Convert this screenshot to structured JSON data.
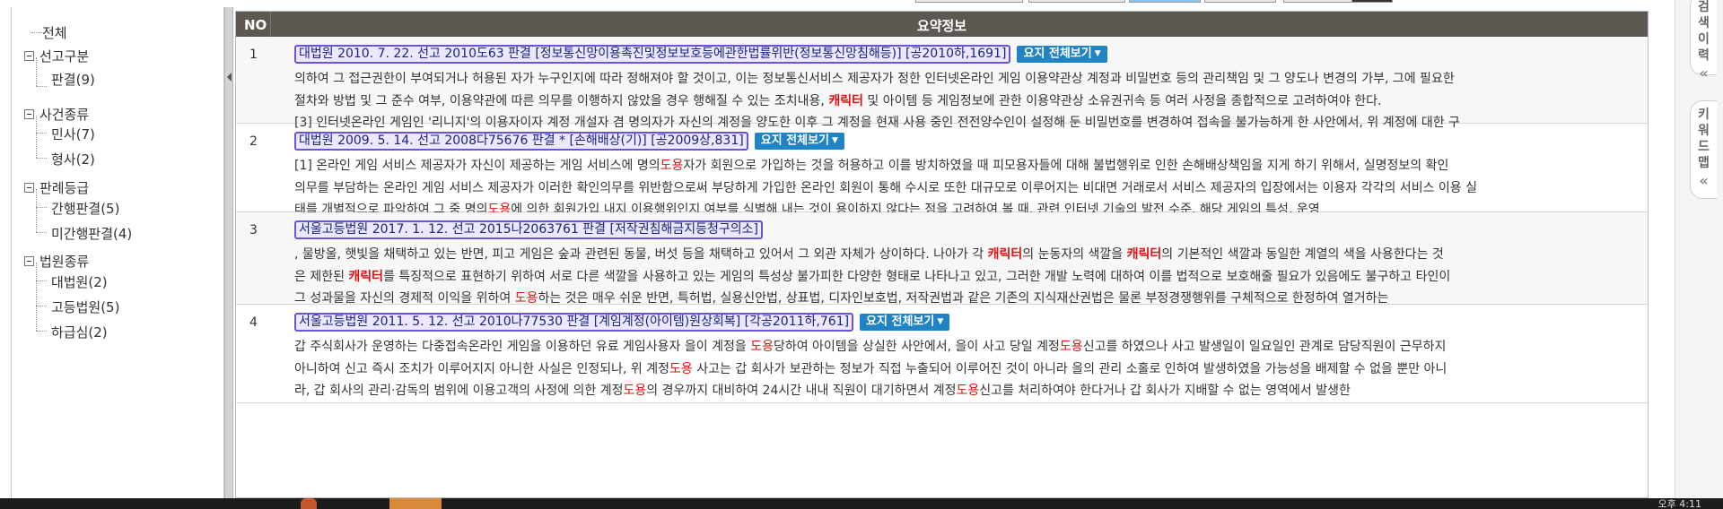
{
  "tree": {
    "all": "전체",
    "groups": [
      {
        "label": "선고구분",
        "children": [
          "판결(9)"
        ]
      },
      {
        "label": "사건종류",
        "children": [
          "민사(7)",
          "형사(2)"
        ]
      },
      {
        "label": "판례등급",
        "children": [
          "간행판결(5)",
          "미간행판결(4)"
        ]
      },
      {
        "label": "법원종류",
        "children": [
          "대법원(2)",
          "고등법원(5)",
          "하급심(2)"
        ]
      }
    ]
  },
  "table": {
    "col_no": "NO",
    "col_info": "요약정보",
    "yoji_label": "요지 전체보기",
    "rows": [
      {
        "no": "1",
        "title": "대법원 2010. 7. 22. 선고 2010도63 판결 [정보통신망이용촉진및정보보호등에관한법률위반(정보통신망침해등)] [공2010하,1691]",
        "has_yoji": true,
        "lines": [
          [
            {
              "t": "의하여 그 접근권한이 부여되거나 허용된 자가 누구인지에 따라 정해져야 할 것이고, 이는 정보통신서비스 제공자가 정한 인터넷온라인 게임 이용약관상 계정과 비밀번호 등의 관리책임 및 그 양도나 변경의 가부, 그에 필요한"
            }
          ],
          [
            {
              "t": "절차와 방법 및 그 준수 여부, 이용약관에 따른 의무를 이행하지 않았을 경우 행해질 수 있는 조치내용, "
            },
            {
              "t": "캐릭터",
              "h": "kr"
            },
            {
              "t": " 및 아이템 등 게임정보에 관한 이용약관상 소유권귀속 등 여러 사정을 종합적으로 고려하여야 한다."
            }
          ],
          [
            {
              "t": "[3] 인터넷온라인 게임인 '리니지'의 이용자이자 계정 개설자 겸 명의자가 자신의 계정을 양도한 이후 그 계정을 현재 사용 중인 전전양수인이 설정해 둔 비밀번호를 변경하여 접속을 불가능하게 한 사안에서, 위 계정에 대한 구"
            }
          ]
        ]
      },
      {
        "no": "2",
        "title": "대법원 2009. 5. 14. 선고 2008다75676 판결 * [손해배상(기)] [공2009상,831]",
        "has_yoji": true,
        "lines": [
          [
            {
              "t": "[1] 온라인 게임 서비스 제공자가 자신이 제공하는 게임 서비스에 명의"
            },
            {
              "t": "도용",
              "h": "do"
            },
            {
              "t": "자가 회원으로 가입하는 것을 허용하고 이를 방치하였을 때 피모용자들에 대해 불법행위로 인한 손해배상책임을 지게 하기 위해서, 실명정보의 확인"
            }
          ],
          [
            {
              "t": "의무를 부담하는 온라인 게임 서비스 제공자가 이러한 확인의무를 위반함으로써 부당하게 가입한 온라인 회원이 통해 수시로 또한 대규모로 이루어지는 비대면 거래로서 서비스 제공자의 입장에서는 이용자 각각의 서비스 이용 실"
            }
          ],
          [
            {
              "t": "태를 개별적으로 파악하여 그 중 명의"
            },
            {
              "t": "도용",
              "h": "do"
            },
            {
              "t": "에 의한 회원가입 내지 이용행위인지 여부를 식별해 내는 것이 용이하지 않다는 점을 고려하여 볼 때, 관련 인터넷 기술의 발전 수준, 해당 게임의 특성, 운영"
            }
          ]
        ]
      },
      {
        "no": "3",
        "title": "서울고등법원 2017. 1. 12. 선고 2015나2063761 판결 [저작권침해금지등청구의소]",
        "has_yoji": false,
        "lines": [
          [
            {
              "t": ", 물방울, 햇빛을 채택하고 있는 반면, 피고 게임은 숲과 관련된 동물, 버섯 등을 채택하고 있어서 그 외관 자체가 상이하다. 나아가 각 "
            },
            {
              "t": "캐릭터",
              "h": "kr"
            },
            {
              "t": "의 눈동자의 색깔을 "
            },
            {
              "t": "캐릭터",
              "h": "kr"
            },
            {
              "t": "의 기본적인 색깔과 동일한 계열의 색을 사용한다는 것"
            }
          ],
          [
            {
              "t": "은 제한된 "
            },
            {
              "t": "캐릭터",
              "h": "kr"
            },
            {
              "t": "를 특징적으로 표현하기 위하여 서로 다른 색깔을 사용하고 있는 게임의 특성상 불가피한 다양한 형태로 나타나고 있고, 그러한 개발 노력에 대하여 이를 법적으로 보호해줄 필요가 있음에도 불구하고 타인이"
            }
          ],
          [
            {
              "t": "그 성과물을 자신의 경제적 이익을 위하여 "
            },
            {
              "t": "도용",
              "h": "do"
            },
            {
              "t": "하는 것은 매우 쉬운 반면, 특허법, 실용신안법, 상표법, 디자인보호법, 저작권법과 같은 기존의 지식재산권법은 물론 부정경쟁행위를 구체적으로 한정하여 열거하는"
            }
          ]
        ]
      },
      {
        "no": "4",
        "title": "서울고등법원 2011. 5. 12. 선고 2010나77530 판결 [계임계정(아이템)원상회복] [각공2011하,761]",
        "has_yoji": true,
        "lines": [
          [
            {
              "t": "갑 주식회사가 운영하는 다중접속온라인 게임을 이용하던 유료 게임사용자 을이 계정을 "
            },
            {
              "t": "도용",
              "h": "do"
            },
            {
              "t": "당하여 아이템을 상실한 사안에서, 을이 사고 당일 계정"
            },
            {
              "t": "도용",
              "h": "do"
            },
            {
              "t": "신고를 하였으나 사고 발생일이 일요일인 관계로 담당직원이 근무하지"
            }
          ],
          [
            {
              "t": "아니하여 신고 즉시 조치가 이루어지지 아니한 사실은 인정되나, 위 계정"
            },
            {
              "t": "도용",
              "h": "do"
            },
            {
              "t": " 사고는 갑 회사가 보관하는 정보가 직접 누출되어 이루어진 것이 아니라 을의 관리 소홀로 인하여 발생하였을 가능성을 배제할 수 없을 뿐만 아니"
            }
          ],
          [
            {
              "t": "라, 갑 회사의 관리·감독의 범위에 이용고객의 사정에 의한 계정"
            },
            {
              "t": "도용",
              "h": "do"
            },
            {
              "t": "의 경우까지 대비하여 24시간 내내 직원이 대기하면서 계정"
            },
            {
              "t": "도용",
              "h": "do"
            },
            {
              "t": "신고를 처리하여야 한다거나 갑 회사가 지배할 수 없는 영역에서 발생한"
            }
          ]
        ]
      }
    ]
  },
  "right_tabs": [
    "검색이력",
    "키워드맵"
  ],
  "taskbar": {
    "clock": "오후 4:11"
  }
}
